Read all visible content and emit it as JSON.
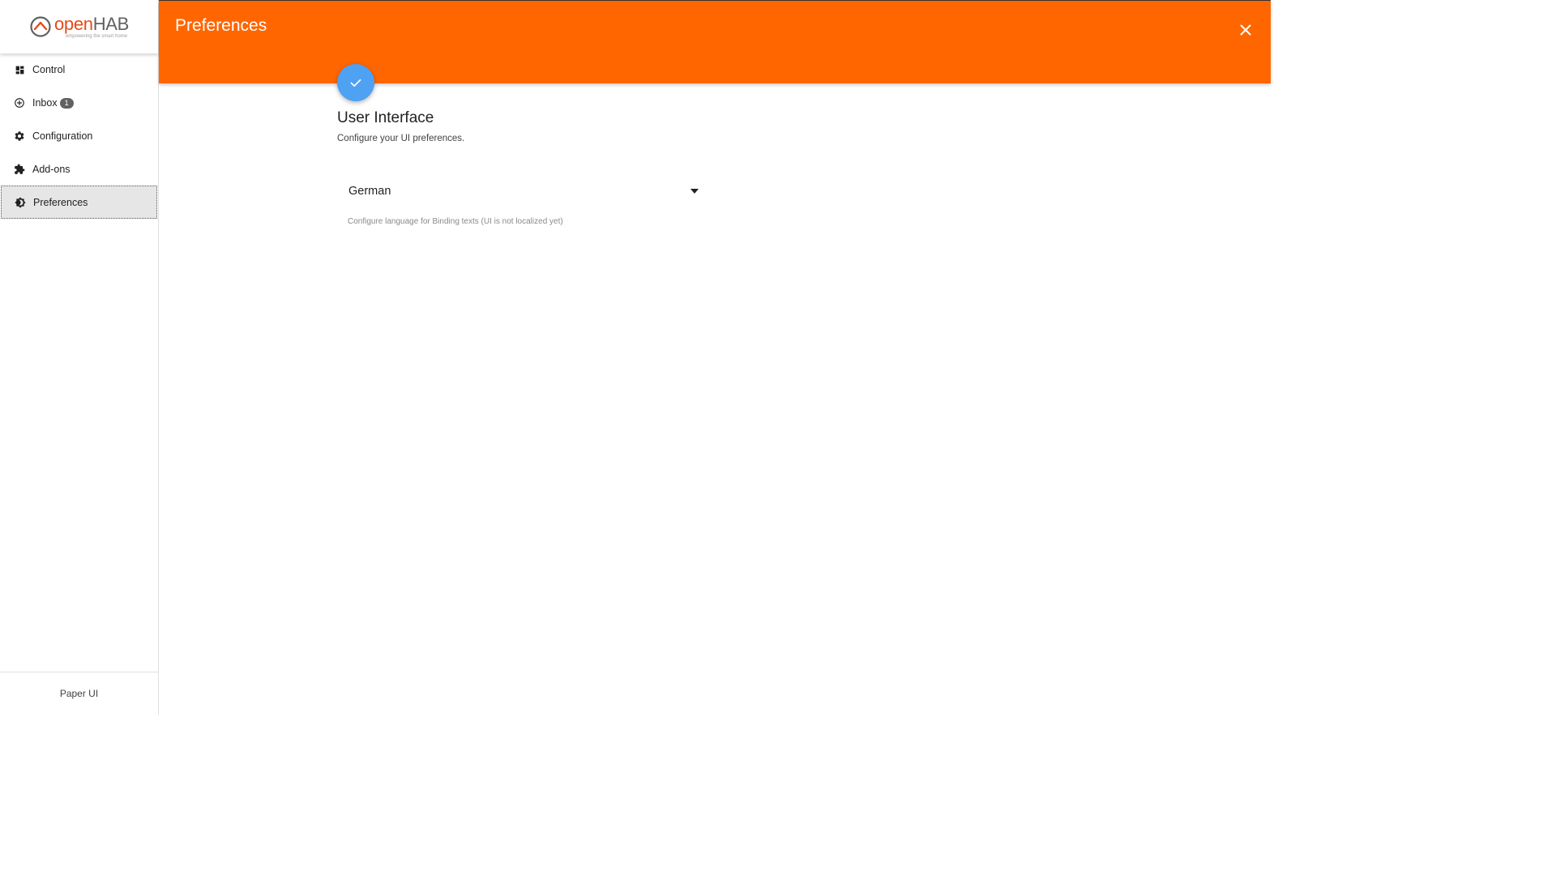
{
  "brand": {
    "logo_open": "open",
    "logo_hab": "HAB",
    "logo_tagline": "empowering the smart home"
  },
  "sidebar": {
    "items": [
      {
        "label": "Control",
        "icon": "dashboard-icon"
      },
      {
        "label": "Inbox",
        "icon": "add-circle-icon",
        "badge": "1"
      },
      {
        "label": "Configuration",
        "icon": "gear-icon"
      },
      {
        "label": "Add-ons",
        "icon": "puzzle-icon"
      },
      {
        "label": "Preferences",
        "icon": "brightness-icon",
        "active": true
      }
    ],
    "footer": "Paper UI"
  },
  "header": {
    "title": "Preferences",
    "close_icon": "close-icon",
    "color": "#ff6600"
  },
  "fab": {
    "icon": "check-icon",
    "color": "#4ea1f3"
  },
  "main": {
    "section_title": "User Interface",
    "section_subtitle": "Configure your UI preferences.",
    "language_select": {
      "value": "German",
      "hint": "Configure language for Binding texts (UI is not localized yet)"
    }
  }
}
